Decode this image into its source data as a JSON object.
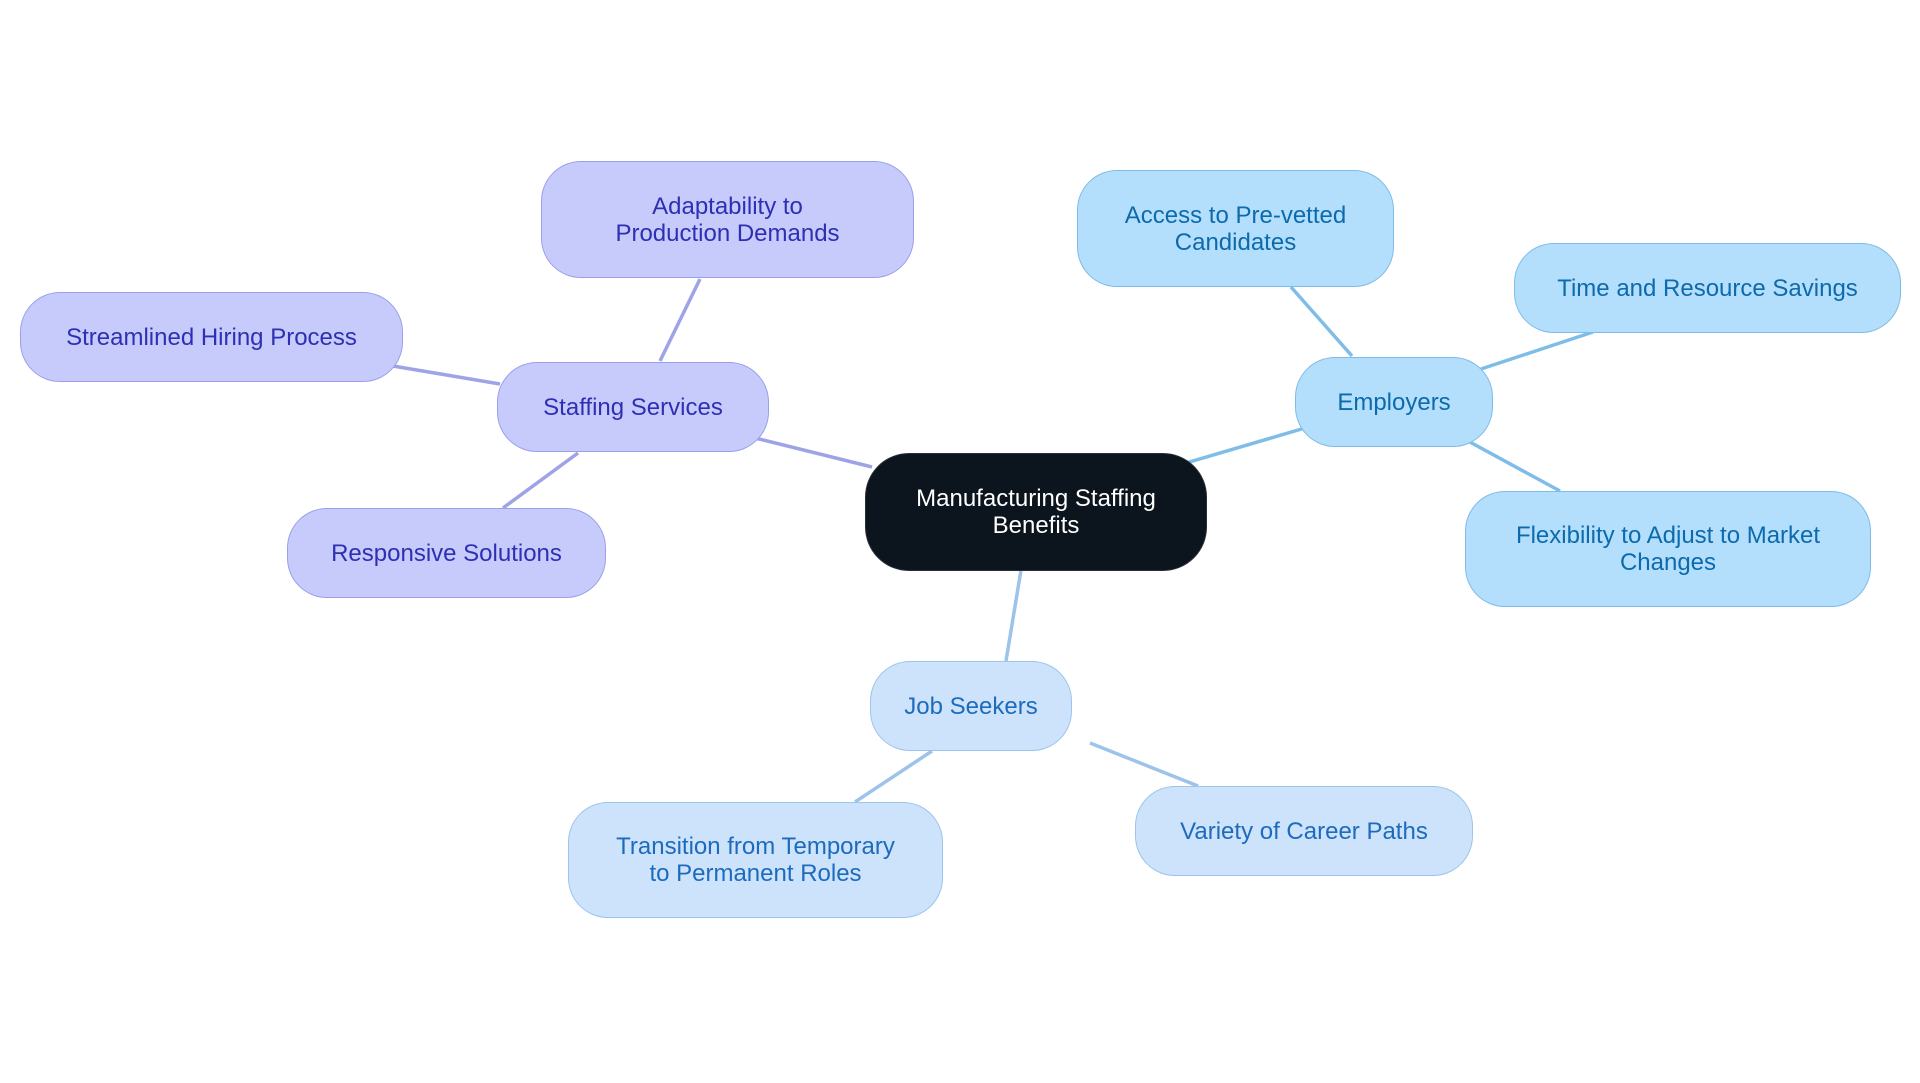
{
  "diagram": {
    "type": "mindmap",
    "root": {
      "id": "root",
      "label": "Manufacturing Staffing Benefits",
      "theme": "root"
    },
    "branches": [
      {
        "id": "staffing",
        "label": "Staffing Services",
        "theme": "purple",
        "edge_color": "#9ea3e6",
        "children": [
          {
            "id": "adaptability",
            "label": "Adaptability to Production Demands"
          },
          {
            "id": "streamlined",
            "label": "Streamlined Hiring Process"
          },
          {
            "id": "responsive",
            "label": "Responsive Solutions"
          }
        ]
      },
      {
        "id": "employers",
        "label": "Employers",
        "theme": "sky",
        "edge_color": "#7fbde9",
        "children": [
          {
            "id": "access",
            "label": "Access to Pre-vetted Candidates"
          },
          {
            "id": "time",
            "label": "Time and Resource Savings"
          },
          {
            "id": "flexibility",
            "label": "Flexibility to Adjust to Market Changes"
          }
        ]
      },
      {
        "id": "jobseekers",
        "label": "Job Seekers",
        "theme": "pale",
        "edge_color": "#9dc3ea",
        "children": [
          {
            "id": "transition",
            "label": "Transition from Temporary to Permanent Roles"
          },
          {
            "id": "variety",
            "label": "Variety of Career Paths"
          }
        ]
      }
    ]
  },
  "colors": {
    "root_fill": "#0c141d",
    "purple_fill": "#c7cbfc",
    "purple_text": "#2e2fb3",
    "sky_fill": "#b3dffc",
    "sky_text": "#0d6aac",
    "pale_fill": "#cde3fb",
    "pale_text": "#1d6bbd"
  }
}
